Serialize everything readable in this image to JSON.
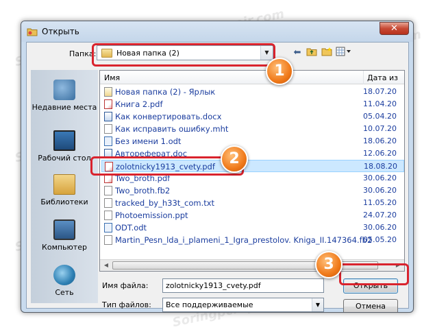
{
  "dialog": {
    "title": "Открыть",
    "close_label": "✕"
  },
  "toolbar": {
    "folder_label": "Папка:",
    "folder_value": "Новая папка (2)",
    "icons": [
      "back-icon",
      "up-folder-icon",
      "new-folder-icon",
      "view-menu-icon"
    ]
  },
  "sidebar": {
    "items": [
      {
        "label": "Недавние места",
        "icon": "recent-places-icon"
      },
      {
        "label": "Рабочий стол",
        "icon": "desktop-icon"
      },
      {
        "label": "Библиотеки",
        "icon": "libraries-icon"
      },
      {
        "label": "Компьютер",
        "icon": "computer-icon"
      },
      {
        "label": "Сеть",
        "icon": "network-icon"
      }
    ]
  },
  "filelist": {
    "columns": {
      "name": "Имя",
      "date": "Дата из"
    },
    "files": [
      {
        "name": "Новая папка (2) - Ярлык",
        "date": "18.07.20",
        "type": "lnk"
      },
      {
        "name": "Книга 2.pdf",
        "date": "11.04.20",
        "type": "pdf"
      },
      {
        "name": "Как конвертировать.docx",
        "date": "05.04.20",
        "type": "doc"
      },
      {
        "name": "Как исправить ошибку.mht",
        "date": "10.07.20",
        "type": "txt"
      },
      {
        "name": "Без имени 1.odt",
        "date": "18.06.20",
        "type": "odt"
      },
      {
        "name": "Автореферат.doc",
        "date": "12.06.20",
        "type": "doc"
      },
      {
        "name": "zolotnicky1913_cvety.pdf",
        "date": "18.08.20",
        "type": "pdf"
      },
      {
        "name": "Two_broth.pdf",
        "date": "30.06.20",
        "type": "pdf"
      },
      {
        "name": "Two_broth.fb2",
        "date": "30.06.20",
        "type": "txt"
      },
      {
        "name": "tracked_by_h33t_com.txt",
        "date": "11.05.20",
        "type": "txt"
      },
      {
        "name": "Photoemission.ppt",
        "date": "24.07.20",
        "type": "txt"
      },
      {
        "name": "ODT.odt",
        "date": "30.06.20",
        "type": "odt"
      },
      {
        "name": "Martin_Pesn_lda_i_plameni_1_Igra_prestolov. Kniga_II.147364.fb2",
        "date": "05.05.20",
        "type": "txt"
      }
    ],
    "selected_index": 6
  },
  "bottom": {
    "filename_label": "Имя файла:",
    "filename_value": "zolotnicky1913_cvety.pdf",
    "filetype_label": "Тип файлов:",
    "filetype_value": "Все поддерживаемые",
    "open_button": "Открыть",
    "cancel_button": "Отмена"
  },
  "annotations": {
    "badge1": "1",
    "badge2": "2",
    "badge3": "3",
    "highlight_color": "#d9232d",
    "badge_color": "#f07a1a"
  },
  "watermark": "Soringpcrepair.com"
}
